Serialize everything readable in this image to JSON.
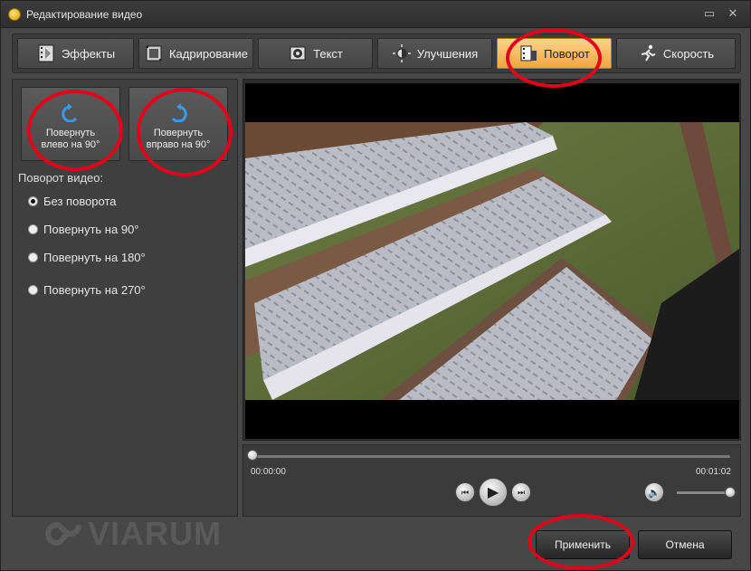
{
  "window": {
    "title": "Редактирование видео"
  },
  "tabs": [
    {
      "label": "Эффекты",
      "icon": "film-effects-icon"
    },
    {
      "label": "Кадрирование",
      "icon": "crop-film-icon"
    },
    {
      "label": "Текст",
      "icon": "text-disc-icon"
    },
    {
      "label": "Улучшения",
      "icon": "brightness-icon"
    },
    {
      "label": "Поворот",
      "icon": "rotate-film-icon",
      "active": true
    },
    {
      "label": "Скорость",
      "icon": "running-man-icon"
    }
  ],
  "rotate_buttons": {
    "left": {
      "line1": "Повернуть",
      "line2": "влево  на 90°"
    },
    "right": {
      "line1": "Повернуть",
      "line2": "вправо на 90°"
    }
  },
  "rotation": {
    "label": "Поворот видео:",
    "options": [
      "Без поворота",
      "Повернуть на 90°",
      "Повернуть на 180°",
      "Повернуть на 270°"
    ],
    "selected": 0
  },
  "player": {
    "time_start": "00:00:00",
    "time_end": "00:01:02",
    "progress": 0,
    "volume": 1
  },
  "buttons": {
    "apply": "Применить",
    "cancel": "Отмена"
  },
  "watermark": "VIARUM",
  "colors": {
    "accent": "#f0a640",
    "highlight_ring": "#e4001b"
  }
}
